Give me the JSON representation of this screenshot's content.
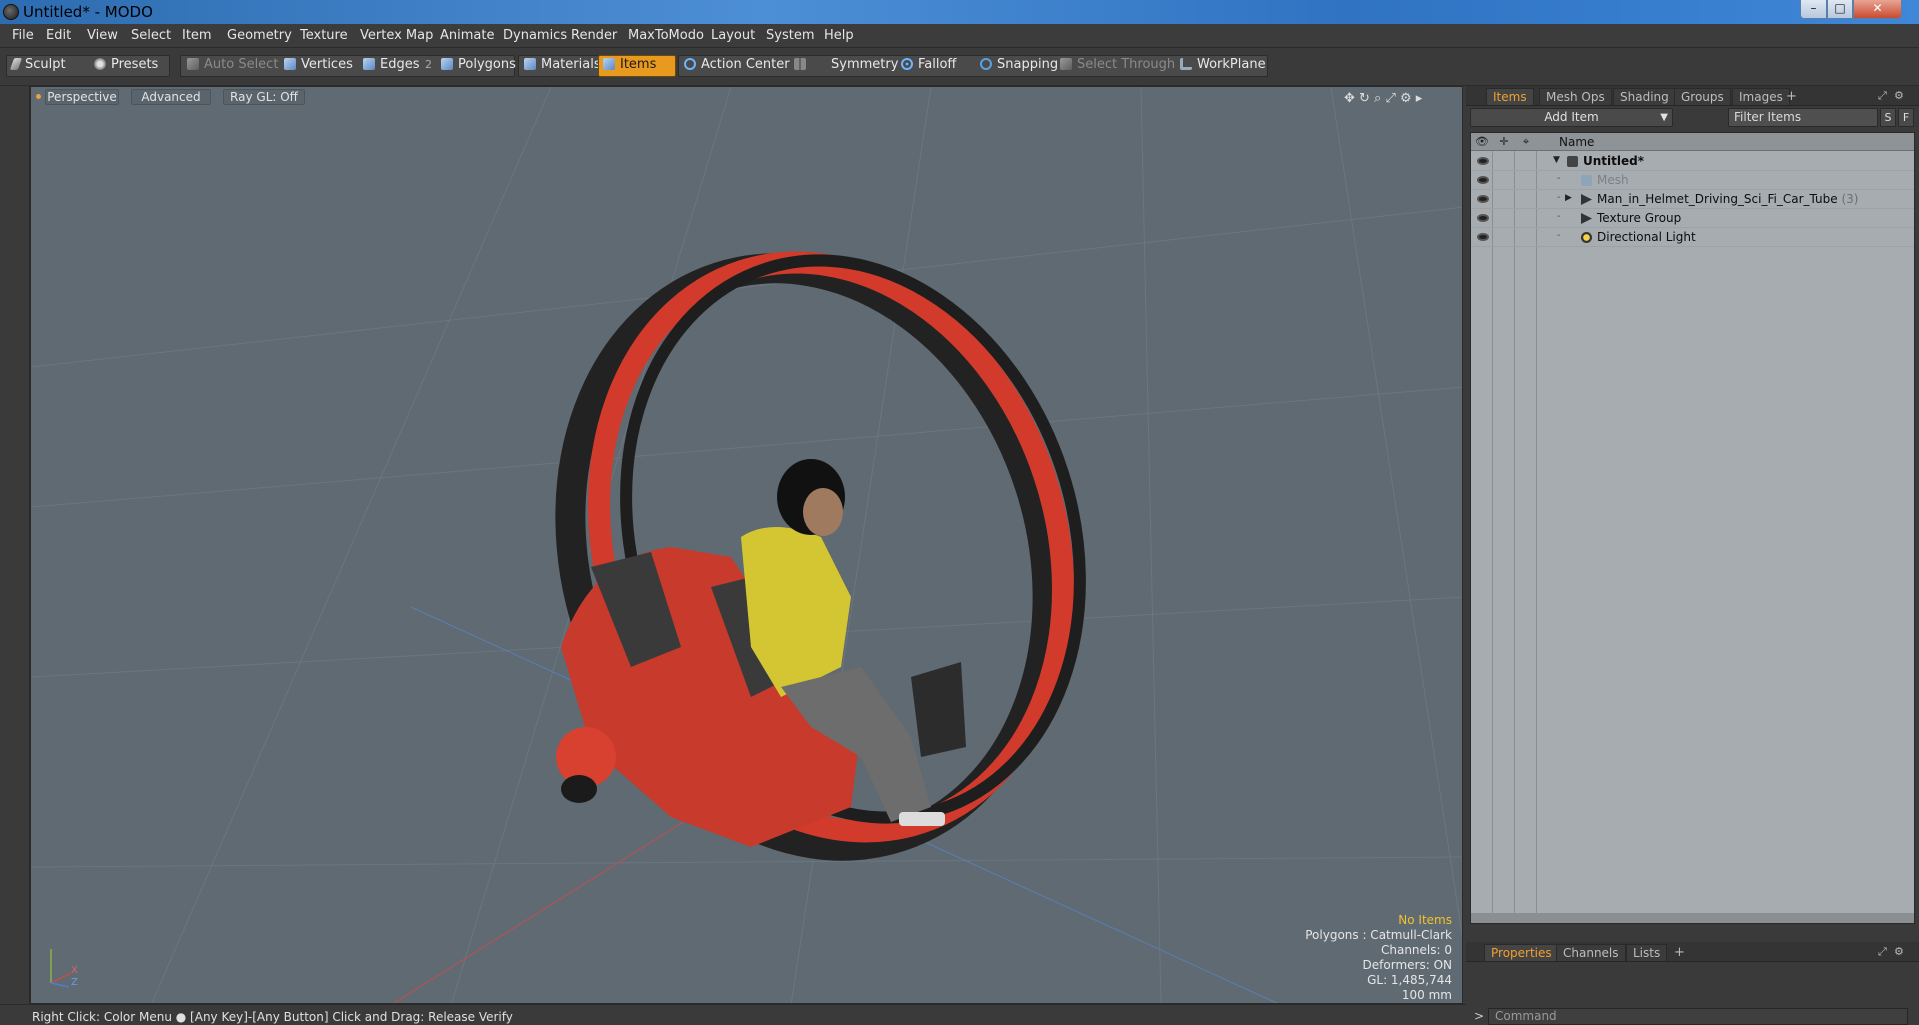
{
  "window": {
    "title": "Untitled* - MODO",
    "min_glyph": "–",
    "max_glyph": "□",
    "close_glyph": "✕"
  },
  "menu": [
    "File",
    "Edit",
    "View",
    "Select",
    "Item",
    "Geometry",
    "Texture",
    "Vertex Map",
    "Animate",
    "Dynamics",
    "Render",
    "MaxToModo",
    "Layout",
    "System",
    "Help"
  ],
  "toolbar": {
    "sculpt": "Sculpt",
    "presets": "Presets",
    "auto_select": "Auto Select",
    "vertices": "Vertices",
    "edges": "Edges",
    "edges_count": "2",
    "polygons": "Polygons",
    "materials": "Materials",
    "items": "Items",
    "action_center": "Action Center",
    "symmetry": "Symmetry",
    "falloff": "Falloff",
    "snapping": "Snapping",
    "select_through": "Select Through",
    "workplane": "WorkPlane"
  },
  "viewport": {
    "tabs": [
      "Perspective",
      "Advanced",
      "Ray GL: Off"
    ],
    "icons": "✥ ↻ ⌕ ⤢ ⚙ ▸",
    "info": {
      "selection": "No Items",
      "polygons": "Polygons : Catmull-Clark",
      "channels": "Channels: 0",
      "deformers": "Deformers: ON",
      "gl": "GL: 1,485,744",
      "scale": "100 mm"
    },
    "axes": {
      "x": "X",
      "z": "Z"
    }
  },
  "right_panel": {
    "tabs": [
      "Items",
      "Mesh Ops",
      "Shading",
      "Groups",
      "Images"
    ],
    "add_item": "Add Item",
    "filter_placeholder": "Filter Items",
    "btn_s": "S",
    "btn_f": "F",
    "column_name": "Name",
    "tree": [
      {
        "label": "Untitled*",
        "bold": true
      },
      {
        "label": "Mesh",
        "dim": true
      },
      {
        "label": "Man_in_Helmet_Driving_Sci_Fi_Car_Tube",
        "count": "(3)"
      },
      {
        "label": "Texture Group"
      },
      {
        "label": "Directional Light"
      }
    ],
    "bottom_tabs": [
      "Properties",
      "Channels",
      "Lists"
    ],
    "command_placeholder": "Command",
    "prompt": ">"
  },
  "status": {
    "text": "Right Click: Color Menu ●  [Any Key]-[Any Button] Click and Drag: Release Verify"
  },
  "colors": {
    "accent": "#e89a1e",
    "viewport_bg": "#5f6a72",
    "tab_active": "#f0a030"
  }
}
